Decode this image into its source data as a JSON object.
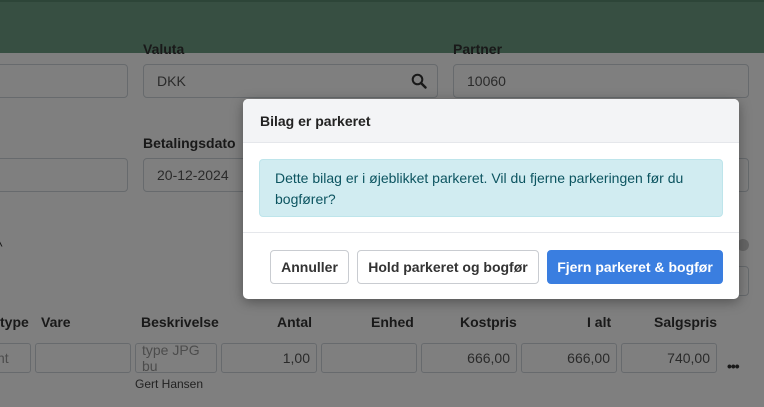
{
  "form": {
    "labels": {
      "currency": "Valuta",
      "partner": "Partner",
      "payment_date": "Betalingsdato"
    },
    "currency_value": "DKK",
    "partner_value": "10060",
    "payment_date_value": "20-12-2024"
  },
  "table": {
    "headers": [
      "type",
      "Vare",
      "Beskrivelse",
      "Antal",
      "Enhed",
      "Kostpris",
      "I alt",
      "Salgspris"
    ],
    "row": {
      "type_value": "nt",
      "description_placeholder": "type JPG bu",
      "quantity": "1,00",
      "cost_price": "666,00",
      "total": "666,00",
      "sales_price": "740,00"
    },
    "row_user": "Gert Hansen",
    "more_label": "•••"
  },
  "modal": {
    "title": "Bilag er parkeret",
    "message": "Dette bilag er i øjeblikket parkeret. Vil du fjerne parkeringen før du bogfører?",
    "buttons": {
      "cancel": "Annuller",
      "keep_and_post": "Hold parkeret og bogfør",
      "remove_and_post": "Fjern parkeret & bogfør"
    }
  },
  "colors": {
    "topbar": "#6e9f85",
    "primary": "#3a7ee0",
    "alert_bg": "#d1ecf1",
    "alert_text": "#0c5460"
  }
}
